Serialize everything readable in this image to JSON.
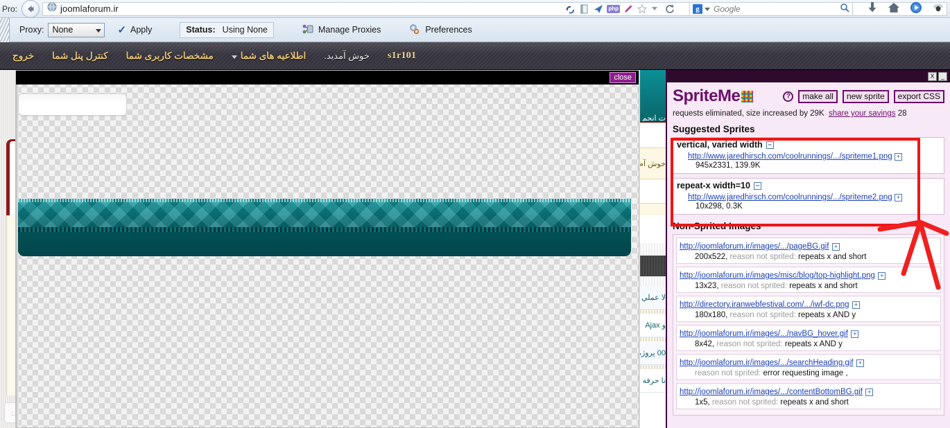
{
  "browser": {
    "pro_label": "Pro:",
    "url": "joomlaforum.ir",
    "back_icon": "back-arrow-icon",
    "globe_icon": "globe-icon",
    "addon_icons": [
      "joomla-icon",
      "book-icon",
      "paper-plane-icon",
      "php-icon",
      "pencil-icon",
      "star-icon",
      "dropdown-caret-icon",
      "reload-icon"
    ],
    "php_badge": "php",
    "search": {
      "engine": "Google",
      "placeholder": "Google",
      "icon": "magnifier-icon"
    },
    "right_icons": [
      "download-icon",
      "home-icon",
      "media-play-icon",
      "bug-icon"
    ]
  },
  "proxy_toolbar": {
    "proxy_label": "Proxy:",
    "proxy_value": "None",
    "apply_label": "Apply",
    "apply_icon": "checkmark-icon",
    "status_label": "Status:",
    "status_value": "Using None",
    "manage_proxies_label": "Manage Proxies",
    "manage_proxies_icon": "proxy-network-icon",
    "preferences_label": "Preferences",
    "preferences_icon": "gear-icon"
  },
  "site_nav": {
    "username": "s1r101",
    "welcome": "خوش آمدید.",
    "links": [
      "اطلاعیه های شما",
      "مشخصات کاربری شما",
      "کنترل پنل شما",
      "خروج"
    ]
  },
  "sprite_preview": {
    "close_label": "close"
  },
  "spriteme": {
    "window_buttons": {
      "close": "X",
      "minimize": "_"
    },
    "title": "SpriteMe",
    "logo_icon": "spriteme-mosaic-icon",
    "help_icon": "help-question-icon",
    "buttons": [
      "make all",
      "new sprite",
      "export CSS"
    ],
    "summary_prefix": "requests eliminated, size increased by 29K",
    "summary_link": "share your savings",
    "summary_suffix": "28",
    "suggested_title": "Suggested Sprites",
    "suggested": [
      {
        "name": "vertical, varied width",
        "toggle": "−",
        "url": "http://www.jaredhirsch.com/coolrunnings/.../spriteme1.png",
        "expand": "+",
        "meta": "945x2331, 139.9K"
      },
      {
        "name": "repeat-x width=10",
        "toggle": "−",
        "url": "http://www.jaredhirsch.com/coolrunnings/.../spriteme2.png",
        "expand": "+",
        "meta": "10x298, 0.3K"
      }
    ],
    "nonsprited_title": "Non-Sprited Images",
    "nonsprited": [
      {
        "url": "http://joomlaforum.ir/images/.../pageBG.gif",
        "expand": "+",
        "dim": "200x522,",
        "reason_label": "reason not sprited:",
        "reason": "repeats x and short"
      },
      {
        "url": "http://joomlaforum.ir/images/misc/blog/top-highlight.png",
        "expand": "+",
        "dim": "13x23,",
        "reason_label": "reason not sprited:",
        "reason": "repeats x and short"
      },
      {
        "url": "http://directory.iranwebfestival.com/.../iwf-dc.png",
        "expand": "+",
        "dim": "180x180,",
        "reason_label": "reason not sprited:",
        "reason": "repeats x AND y"
      },
      {
        "url": "http://joomlaforum.ir/images/.../navBG_hover.gif",
        "expand": "+",
        "dim": "8x42,",
        "reason_label": "reason not sprited:",
        "reason": "repeats x AND y"
      },
      {
        "url": "http://joomlaforum.ir/images/.../searchHeading.gif",
        "expand": "+",
        "dim": "",
        "reason_label": "reason not sprited:",
        "reason": "error requesting image ,"
      },
      {
        "url": "http://joomlaforum.ir/images/.../contentBottomBG.gif",
        "expand": "+",
        "dim": "1x5,",
        "reason_label": "reason not sprited:",
        "reason": "repeats x and short"
      }
    ]
  },
  "underlying_page": {
    "strip_texts": [
      "ت انجم",
      "خوش آم",
      "لا عملي",
      "و Ajax",
      "00 پروژه",
      "نا حرفه"
    ]
  },
  "annotations": {
    "arrow": "red-hand-drawn-arrow"
  },
  "colors": {
    "spriteme_purple": "#6b0f6b",
    "panel_bg": "#f7e9f5",
    "highlight_red": "#f01414",
    "link_blue": "#1b3fb5",
    "teal": "#0a6f76"
  }
}
